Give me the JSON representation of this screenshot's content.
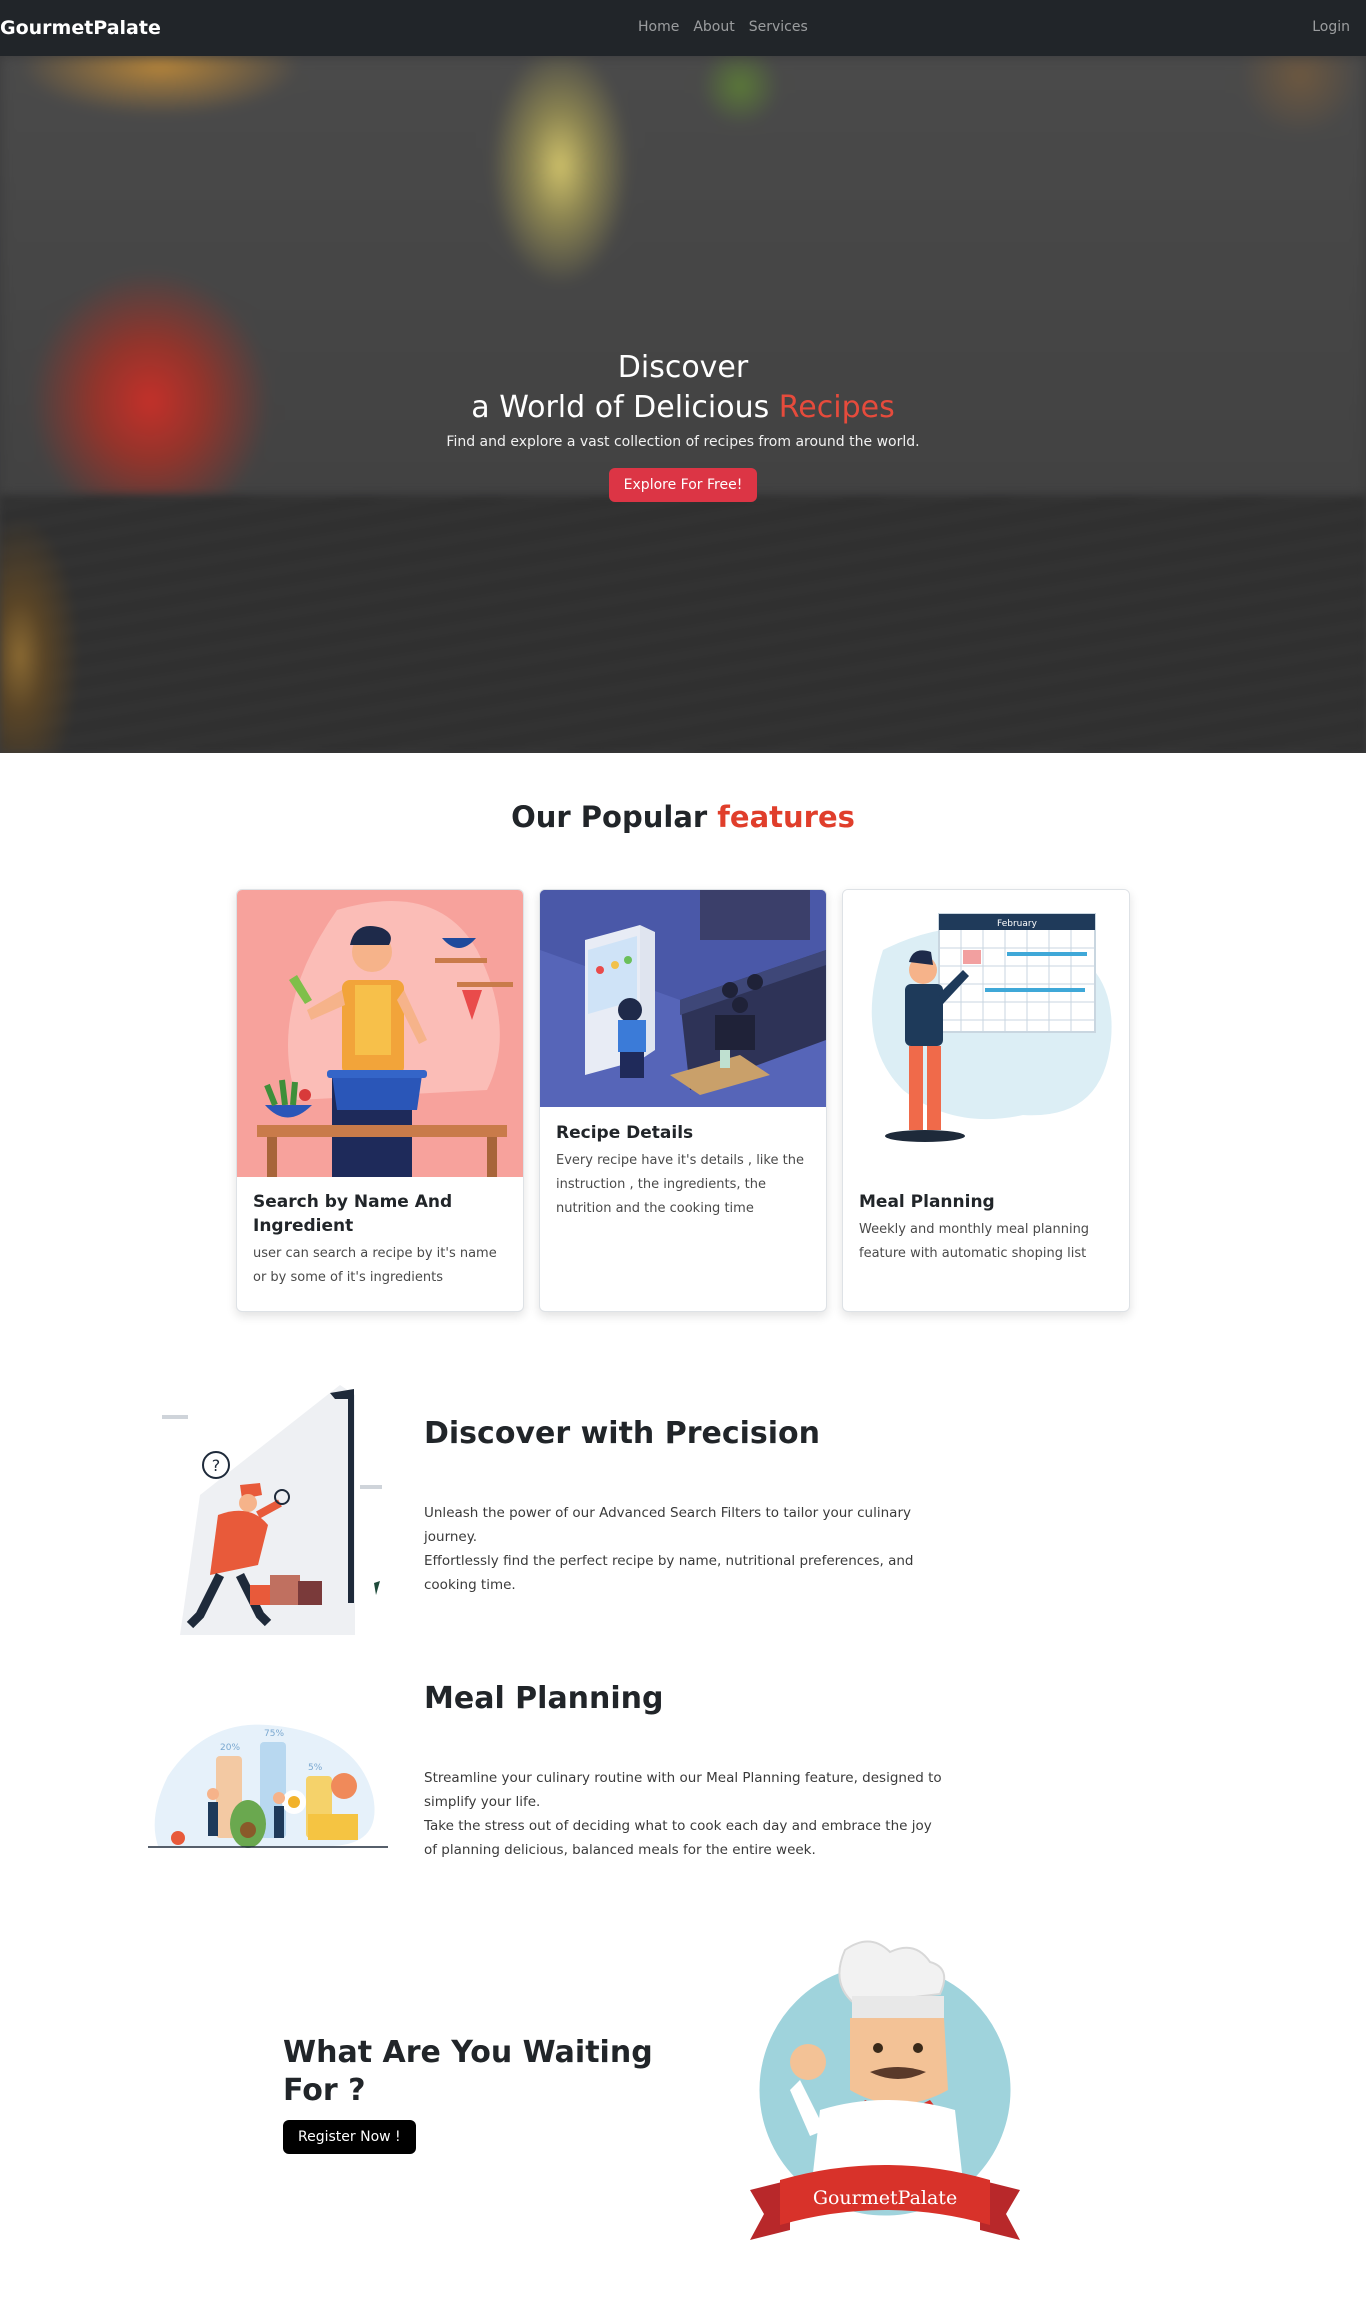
{
  "navbar": {
    "brand": "GourmetPalate",
    "links": [
      "Home",
      "About",
      "Services"
    ],
    "login": "Login"
  },
  "hero": {
    "title_line1": "Discover",
    "title_line2_prefix": "a World of Delicious ",
    "title_line2_accent": "Recipes",
    "subtitle": "Find and explore a vast collection of recipes from around the world.",
    "cta": "Explore For Free!"
  },
  "features": {
    "title_prefix": "Our Popular ",
    "title_accent": "features",
    "cards": [
      {
        "title": "Search by Name And Ingredient",
        "text": "user can search a recipe by it's name or by some of it's ingredients"
      },
      {
        "title": "Recipe Details",
        "text": "Every recipe have it's details , like the instruction , the ingredients, the nutrition and the cooking time"
      },
      {
        "title": "Meal Planning",
        "text": "Weekly and monthly meal planning feature with automatic shoping list"
      }
    ],
    "calendar_month": "February"
  },
  "sections": [
    {
      "title": "Discover with Precision",
      "para1": "Unleash the power of our Advanced Search Filters to tailor your culinary journey.",
      "para2": "Effortlessly find the perfect recipe by name, nutritional preferences, and cooking time."
    },
    {
      "title": "Meal Planning",
      "para1": "Streamline your culinary routine with our Meal Planning feature, designed to simplify your life.",
      "para2": "Take the stress out of deciding what to cook each day and embrace the joy of planning delicious, balanced meals for the entire week."
    }
  ],
  "illustration_labels": {
    "question": "?",
    "pct_20": "20%",
    "pct_75": "75%",
    "pct_5": "5%"
  },
  "cta": {
    "title": "What Are You Waiting For ?",
    "button": "Register Now !"
  },
  "logo": {
    "text": "GourmetPalate"
  },
  "colors": {
    "accent": "#e03e2b",
    "primary_button": "#dc3545",
    "navbar_bg": "#212529"
  }
}
